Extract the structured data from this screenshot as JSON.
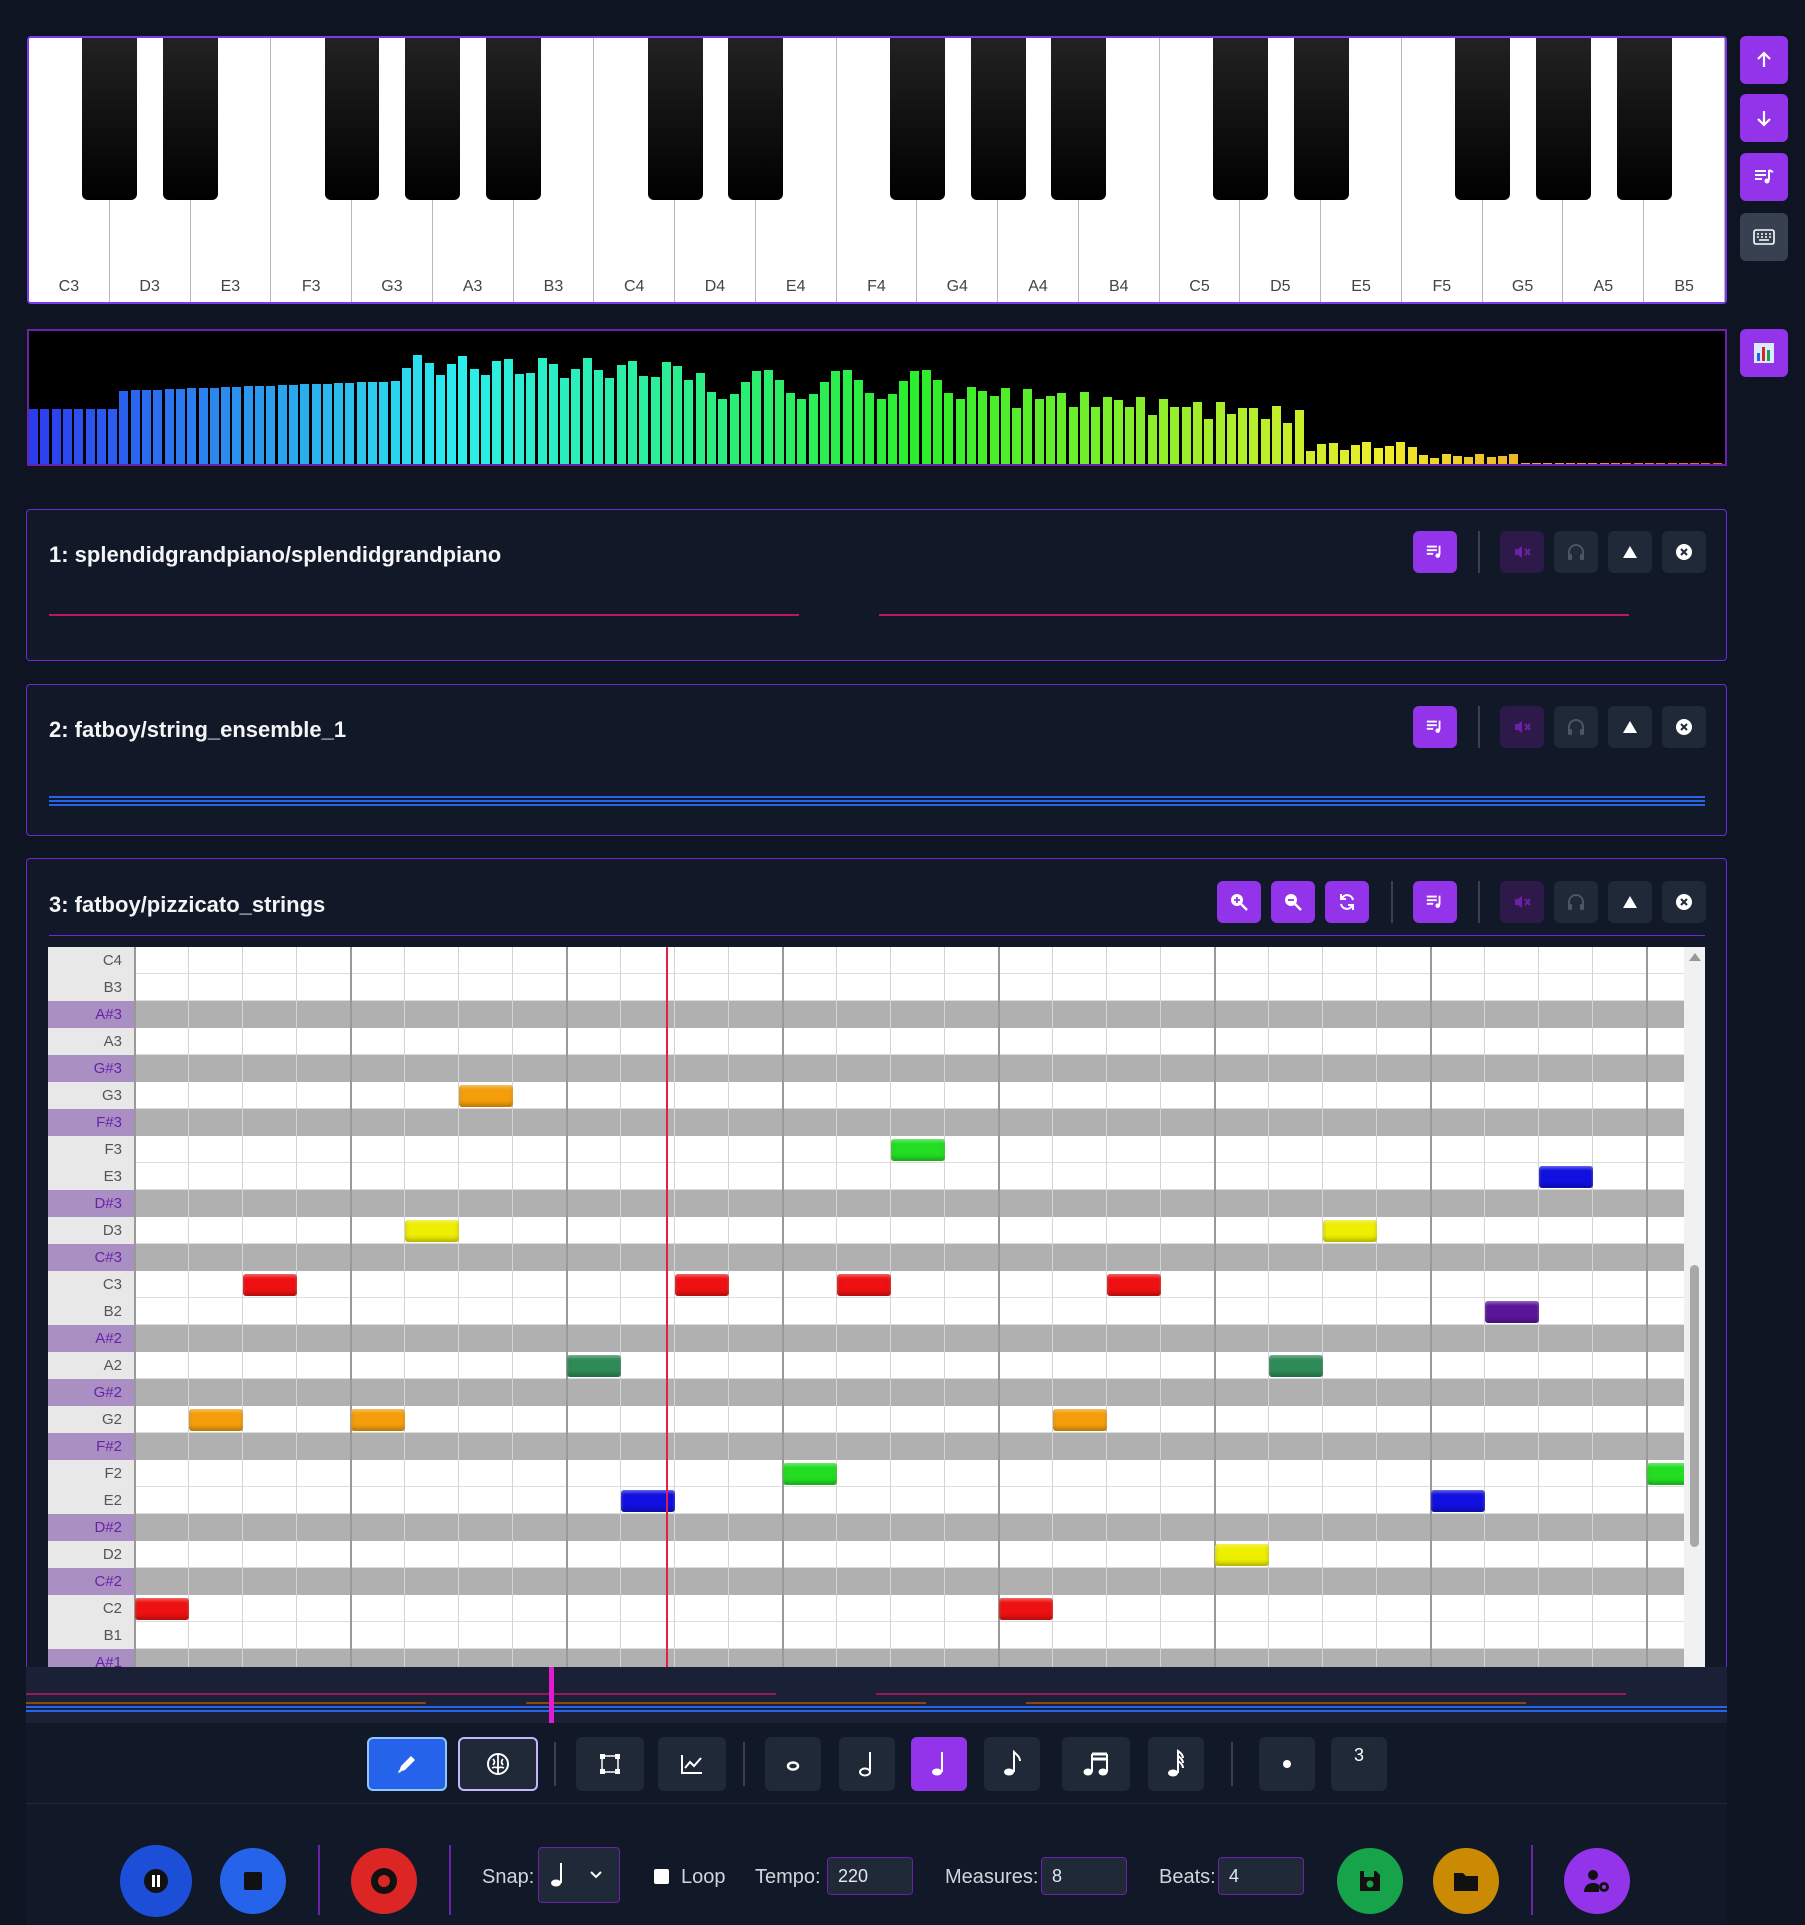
{
  "keyboard": {
    "white_keys": [
      "C3",
      "D3",
      "E3",
      "F3",
      "G3",
      "A3",
      "B3",
      "C4",
      "D4",
      "E4",
      "F4",
      "G4",
      "A4",
      "B4",
      "C5",
      "D5",
      "E5",
      "F5",
      "G5",
      "A5",
      "B5"
    ]
  },
  "sidebar": {
    "buttons": [
      "octave-up-icon",
      "octave-down-icon",
      "add-track-icon",
      "keyboard-icon",
      "visualizer-icon"
    ]
  },
  "tracks": [
    {
      "title": "1: splendidgrandpiano/splendidgrandpiano"
    },
    {
      "title": "2: fatboy/string_ensemble_1"
    },
    {
      "title": "3: fatboy/pizzicato_strings"
    }
  ],
  "piano_roll": {
    "rows": [
      "C4",
      "B3",
      "A#3",
      "A3",
      "G#3",
      "G3",
      "F#3",
      "F3",
      "E3",
      "D#3",
      "D3",
      "C#3",
      "C3",
      "B2",
      "A#2",
      "A2",
      "G#2",
      "G2",
      "F#2",
      "F2",
      "E2",
      "D#2",
      "D2",
      "C#2",
      "C2",
      "B1",
      "A#1"
    ],
    "notes": [
      {
        "pitch": "G3",
        "beat": 6,
        "color": "#f59e0b"
      },
      {
        "pitch": "F3",
        "beat": 14,
        "color": "#22dd22"
      },
      {
        "pitch": "E3",
        "beat": 26,
        "color": "#1010e0"
      },
      {
        "pitch": "D3",
        "beat": 5,
        "color": "#eeee00"
      },
      {
        "pitch": "D3",
        "beat": 22,
        "color": "#eeee00"
      },
      {
        "pitch": "C3",
        "beat": 2,
        "color": "#ee1111"
      },
      {
        "pitch": "C3",
        "beat": 10,
        "color": "#ee1111"
      },
      {
        "pitch": "C3",
        "beat": 13,
        "color": "#ee1111"
      },
      {
        "pitch": "C3",
        "beat": 18,
        "color": "#ee1111"
      },
      {
        "pitch": "B2",
        "beat": 25,
        "color": "#5b1599"
      },
      {
        "pitch": "A2",
        "beat": 8,
        "color": "#2e8b57"
      },
      {
        "pitch": "A2",
        "beat": 21,
        "color": "#2e8b57"
      },
      {
        "pitch": "G2",
        "beat": 1,
        "color": "#f59e0b"
      },
      {
        "pitch": "G2",
        "beat": 4,
        "color": "#f59e0b"
      },
      {
        "pitch": "G2",
        "beat": 17,
        "color": "#f59e0b"
      },
      {
        "pitch": "F2",
        "beat": 12,
        "color": "#22dd22"
      },
      {
        "pitch": "F2",
        "beat": 28,
        "color": "#22dd22"
      },
      {
        "pitch": "E2",
        "beat": 9,
        "color": "#1010e0"
      },
      {
        "pitch": "E2",
        "beat": 24,
        "color": "#1010e0"
      },
      {
        "pitch": "D2",
        "beat": 20,
        "color": "#eeee00"
      },
      {
        "pitch": "C2",
        "beat": 0,
        "color": "#ee1111"
      },
      {
        "pitch": "C2",
        "beat": 16,
        "color": "#ee1111"
      }
    ],
    "playhead_beat": 9.85
  },
  "toolbar": {
    "triplet_label": "3",
    "active_duration": "quarter"
  },
  "transport": {
    "snap_label": "Snap:",
    "snap_value": "quarter",
    "loop_label": "Loop",
    "loop_checked": false,
    "tempo_label": "Tempo:",
    "tempo_value": "220",
    "measures_label": "Measures:",
    "measures_value": "8",
    "beats_label": "Beats:",
    "beats_value": "4"
  },
  "colors": {
    "accent": "#9333ea",
    "play": "#1d4ed8",
    "stop": "#2563eb",
    "record": "#dc2626",
    "save": "#16a34a",
    "open": "#ca8a04"
  }
}
